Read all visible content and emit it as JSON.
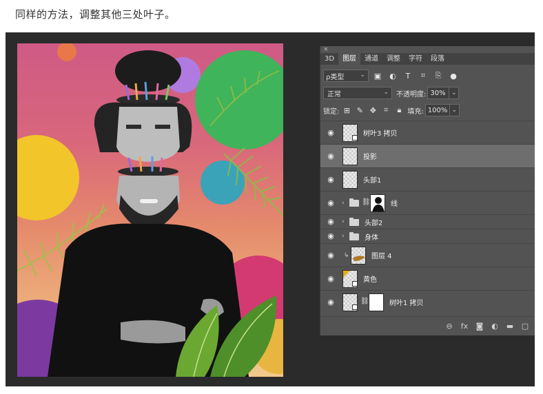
{
  "caption": "同样的方法，调整其他三处叶子。",
  "panel": {
    "close_glyph": "×",
    "tabs": [
      {
        "label": "3D"
      },
      {
        "label": "图层"
      },
      {
        "label": "通道"
      },
      {
        "label": "调整"
      },
      {
        "label": "字符"
      },
      {
        "label": "段落"
      }
    ],
    "filter": {
      "value": "ρ类型",
      "caret": "⌄"
    },
    "blend_mode": {
      "value": "正常",
      "caret": "⌄"
    },
    "opacity": {
      "label": "不透明度:",
      "value": "30%",
      "caret": "⌄"
    },
    "lock": {
      "label": "锁定:"
    },
    "fill": {
      "label": "填充:",
      "value": "100%",
      "caret": "⌄"
    },
    "layers": [
      {
        "name": "树叶3 拷贝"
      },
      {
        "name": "投影"
      },
      {
        "name": "头部1"
      },
      {
        "name": "线"
      },
      {
        "name": "头部2"
      },
      {
        "name": "身体"
      },
      {
        "name": "图层 4"
      },
      {
        "name": "黄色"
      },
      {
        "name": "树叶1 拷贝"
      }
    ],
    "bottom_icons": [
      "link-icon",
      "fx-icon",
      "mask-icon",
      "adjustment-icon",
      "folder-icon",
      "new-layer-icon"
    ],
    "bottom_fx": "fx"
  },
  "colors": {
    "panel_bg": "#535353",
    "selected_row": "#6e6e6e",
    "canvas_pink": "#cf5a86",
    "canvas_peach": "#f2c98c"
  }
}
